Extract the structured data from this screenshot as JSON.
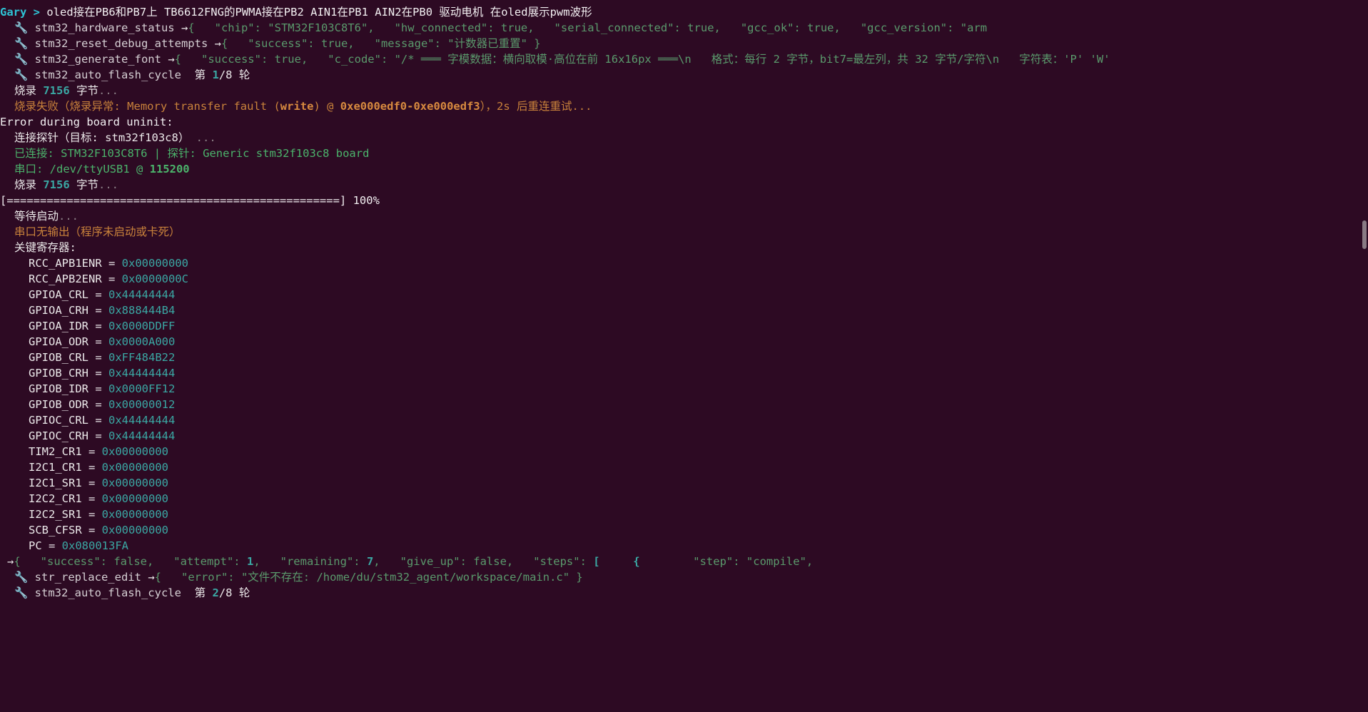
{
  "prompt": {
    "user": "Gary",
    "arrow": " > ",
    "command": "oled接在PB6和PB7上 TB6612FNG的PWMA接在PB2 AIN1在PB1 AIN2在PB0 驱动电机 在oled展示pwm波形"
  },
  "tools": {
    "hw_status": {
      "name": "stm32_hardware_status",
      "json": "{   \"chip\": \"STM32F103C8T6\",   \"hw_connected\": true,   \"serial_connected\": true,   \"gcc_ok\": true,   \"gcc_version\": \"arm"
    },
    "reset_debug": {
      "name": "stm32_reset_debug_attempts",
      "json": "{   \"success\": true,   \"message\": \"计数器已重置\" }"
    },
    "gen_font": {
      "name": "stm32_generate_font",
      "json": "{   \"success\": true,   \"c_code\": \"/* ═══ 字模数据：横向取模·高位在前 16x16px ═══\\n   格式：每行 2 字节，bit7=最左列，共 32 字节/字符\\n   字符表：'P' 'W'"
    },
    "flash1": {
      "name": "stm32_auto_flash_cycle",
      "round_prefix": "第 ",
      "round_cur": "1",
      "round_total": "/8",
      "round_suffix": " 轮"
    },
    "flash2": {
      "name": "stm32_auto_flash_cycle",
      "round_prefix": "第 ",
      "round_cur": "2",
      "round_total": "/8",
      "round_suffix": " 轮"
    },
    "str_replace": {
      "name": "str_replace_edit",
      "json": "{   \"error\": \"文件不存在: /home/du/stm32_agent/workspace/main.c\" }"
    }
  },
  "arrow_symbol": "→",
  "wrench_symbol": "🔧",
  "log": {
    "burn1_label": "烧录 ",
    "burn_bytes": "7156",
    "burn_suffix": " 字节",
    "dots": "...",
    "fail_text": "烧录失败（烧录异常: Memory transfer fault (",
    "fail_write": "write",
    "fail_mid": ") @ ",
    "fail_addr": "0xe000edf0-0xe000edf3",
    "fail_tail": "），2s 后重连重试...",
    "board_error": "Error during board uninit:",
    "connect_probe": "连接探针（目标: stm32f103c8）",
    "connected": "已连接: STM32F103C8T6 | 探针: Generic stm32f103c8 board",
    "serial_label": "串口: /dev/ttyUSB1 @ ",
    "serial_baud": "115200",
    "progress_bar": "[==================================================] 100%",
    "wait_boot": "等待启动",
    "no_output": "串口无输出（程序未启动或卡死）",
    "key_regs": "关键寄存器:"
  },
  "registers": [
    {
      "name": "RCC_APB1ENR",
      "value": "0x00000000"
    },
    {
      "name": "RCC_APB2ENR",
      "value": "0x0000000C"
    },
    {
      "name": "GPIOA_CRL",
      "value": "0x44444444"
    },
    {
      "name": "GPIOA_CRH",
      "value": "0x888444B4"
    },
    {
      "name": "GPIOA_IDR",
      "value": "0x0000DDFF"
    },
    {
      "name": "GPIOA_ODR",
      "value": "0x0000A000"
    },
    {
      "name": "GPIOB_CRL",
      "value": "0xFF484B22"
    },
    {
      "name": "GPIOB_CRH",
      "value": "0x44444444"
    },
    {
      "name": "GPIOB_IDR",
      "value": "0x0000FF12"
    },
    {
      "name": "GPIOB_ODR",
      "value": "0x00000012"
    },
    {
      "name": "GPIOC_CRL",
      "value": "0x44444444"
    },
    {
      "name": "GPIOC_CRH",
      "value": "0x44444444"
    },
    {
      "name": "TIM2_CR1",
      "value": "0x00000000"
    },
    {
      "name": "I2C1_CR1",
      "value": "0x00000000"
    },
    {
      "name": "I2C1_SR1",
      "value": "0x00000000"
    },
    {
      "name": "I2C2_CR1",
      "value": "0x00000000"
    },
    {
      "name": "I2C2_SR1",
      "value": "0x00000000"
    },
    {
      "name": "SCB_CFSR",
      "value": "0x00000000"
    },
    {
      "name": "PC",
      "value": "0x080013FA"
    }
  ],
  "result": {
    "pre": "{   \"success\": false,   \"attempt\": ",
    "attempt": "1",
    "mid": ",   \"remaining\": ",
    "remaining": "7",
    "post": ",   \"give_up\": false,   \"steps\": ",
    "bracket": "[",
    "gap": "     ",
    "brace": "{",
    "tail": "        \"step\": \"compile\","
  },
  "colors": {
    "background": "#2d0a23",
    "prompt_user": "#2ec4d6",
    "json_green": "#4bb36b",
    "muted": "#8b7f86",
    "orange": "#c9823b",
    "teal": "#3aa7a3"
  }
}
